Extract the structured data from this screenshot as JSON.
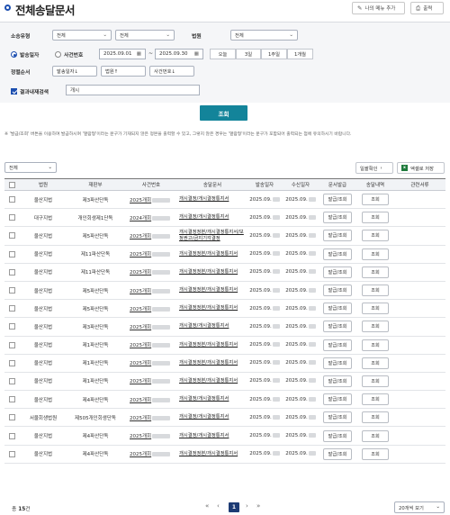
{
  "header": {
    "title": "전체송달문서",
    "my_menu_add": "나의 메뉴 추가",
    "print": "출력"
  },
  "form": {
    "case_type_label": "소송유형",
    "case_type_1": "전체",
    "case_type_2": "전체",
    "court_label": "법원",
    "court_value": "전체",
    "radio_send_date": "발송일자",
    "radio_case_no": "사건번호",
    "date_from": "2025.09.01",
    "date_tilde": "~",
    "date_to": "2025.09.30",
    "period_buttons": [
      "오늘",
      "3일",
      "1주일",
      "1개월"
    ],
    "sort_label": "정렬순서",
    "sort_buttons": [
      "발송일자↓",
      "법원↑",
      "사건번호↓"
    ],
    "result_search_label": "결과내재검색",
    "result_search_value": "개시",
    "search_button": "조회"
  },
  "notice": "※ '발급/조회' 버튼을 이용하여 발급하시며 '열람형'이라는 문구가 기재되지 않은 정본을 출력할 수 있고, 그렇지 않은 경우는 '열람형'이라는 문구가 포함되어 출력되는 점에 유의하시기 바랍니다.",
  "table_toolbar": {
    "filter": "전체",
    "batch_check": "일괄확인",
    "excel_save": "엑셀로 저장",
    "arrow": "›"
  },
  "columns": [
    "법원",
    "재판부",
    "사건번호",
    "송달문서",
    "발송일자",
    "수신일자",
    "문서발급",
    "송달내역",
    "관련서류"
  ],
  "rows": [
    {
      "court": "울산지법",
      "division": "제3파산단독",
      "case": "2025개회",
      "doc": "개시결정/개시결정통지서",
      "sent": "2025.09.",
      "recv": "2025.09.",
      "issue": "발급/조회",
      "history": "조회"
    },
    {
      "court": "대구지법",
      "division": "개인회생제1단독",
      "case": "2024개회",
      "doc": "개시결정/개시결정통지서",
      "sent": "2025.09.",
      "recv": "2025.09.",
      "issue": "발급/조회",
      "history": "조회"
    },
    {
      "court": "울산지법",
      "division": "제5파산단독",
      "case": "2025개회",
      "doc": "개시결정정본/개시결정통지서/보정권고/금지기각결정",
      "sent": "2025.09.",
      "recv": "2025.09.",
      "issue": "발급/조회",
      "history": "조회"
    },
    {
      "court": "울산지법",
      "division": "제11파산단독",
      "case": "2025개회",
      "doc": "개시결정정본/개시결정통지서",
      "sent": "2025.09.",
      "recv": "2025.09.",
      "issue": "발급/조회",
      "history": "조회"
    },
    {
      "court": "울산지법",
      "division": "제11파산단독",
      "case": "2025개회",
      "doc": "개시결정정본/개시결정통지서",
      "sent": "2025.09.",
      "recv": "2025.09.",
      "issue": "발급/조회",
      "history": "조회"
    },
    {
      "court": "울산지법",
      "division": "제5파산단독",
      "case": "2025개회",
      "doc": "개시결정정본/개시결정통지서",
      "sent": "2025.09.",
      "recv": "2025.09.",
      "issue": "발급/조회",
      "history": "조회"
    },
    {
      "court": "울산지법",
      "division": "제5파산단독",
      "case": "2025개회",
      "doc": "개시결정정본/개시결정통지서",
      "sent": "2025.09.",
      "recv": "2025.09.",
      "issue": "발급/조회",
      "history": "조회"
    },
    {
      "court": "울산지법",
      "division": "제3파산단독",
      "case": "2025개회",
      "doc": "개시결정/개시결정통지서",
      "sent": "2025.09.",
      "recv": "2025.09.",
      "issue": "발급/조회",
      "history": "조회"
    },
    {
      "court": "울산지법",
      "division": "제1파산단독",
      "case": "2025개회",
      "doc": "개시결정정본/개시결정통지서",
      "sent": "2025.09.",
      "recv": "2025.09.",
      "issue": "발급/조회",
      "history": "조회"
    },
    {
      "court": "울산지법",
      "division": "제1파산단독",
      "case": "2025개회",
      "doc": "개시결정정본/개시결정통지서",
      "sent": "2025.09.",
      "recv": "2025.09.",
      "issue": "발급/조회",
      "history": "조회"
    },
    {
      "court": "울산지법",
      "division": "제1파산단독",
      "case": "2025개회",
      "doc": "개시결정정본/개시결정통지서",
      "sent": "2025.09.",
      "recv": "2025.09.",
      "issue": "발급/조회",
      "history": "조회"
    },
    {
      "court": "울산지법",
      "division": "제4파산단독",
      "case": "2025개회",
      "doc": "개시결정/개시결정통지서",
      "sent": "2025.09.",
      "recv": "2025.09.",
      "issue": "발급/조회",
      "history": "조회"
    },
    {
      "court": "서울회생법원",
      "division": "제505개인회생단독",
      "case": "2025개회",
      "doc": "개시결정/개시결정통지서",
      "sent": "2025.09.",
      "recv": "2025.09.",
      "issue": "발급/조회",
      "history": "조회"
    },
    {
      "court": "울산지법",
      "division": "제4파산단독",
      "case": "2025개회",
      "doc": "개시결정/개시결정통지서",
      "sent": "2025.09.",
      "recv": "2025.09.",
      "issue": "발급/조회",
      "history": "조회"
    },
    {
      "court": "울산지법",
      "division": "제4파산단독",
      "case": "2025개회",
      "doc": "개시결정정본/개시결정통지서",
      "sent": "2025.09.",
      "recv": "2025.09.",
      "issue": "발급/조회",
      "history": "조회"
    }
  ],
  "footer": {
    "total_prefix": "총",
    "total_count": "15",
    "total_suffix": "건",
    "page": "1",
    "first": "«",
    "prev": "‹",
    "next": "›",
    "last": "»",
    "page_size": "20개씩 보기"
  },
  "colors": {
    "accent": "#1d4fb0",
    "search_button": "#13849a",
    "page_active": "#1d3b74",
    "excel": "#1e7a3c"
  }
}
